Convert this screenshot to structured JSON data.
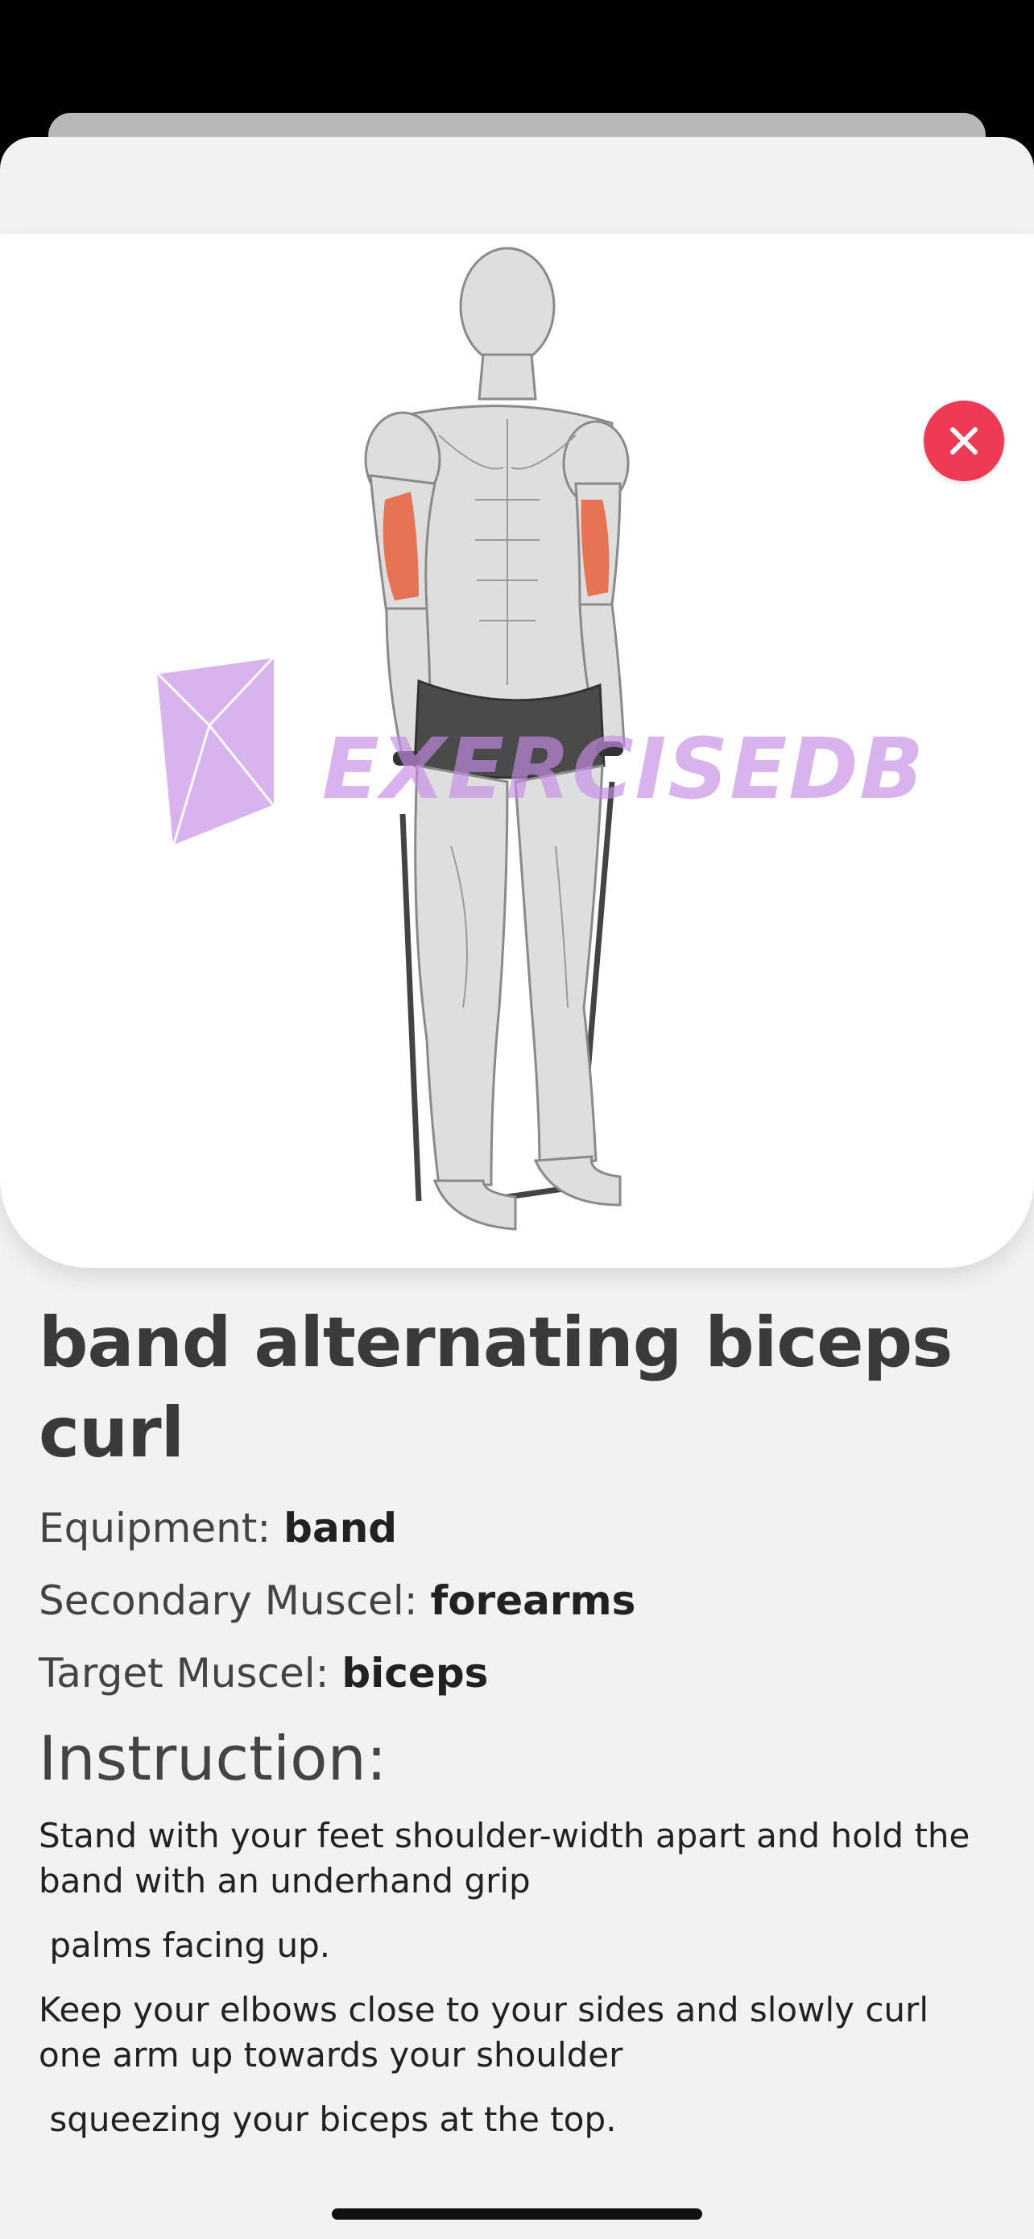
{
  "exercise": {
    "title": "band alternating biceps curl",
    "watermark": "EXERCISEDB",
    "equipment_label": "Equipment: ",
    "equipment_value": "band",
    "secondary_label": "Secondary Muscel: ",
    "secondary_value": "forearms",
    "target_label": "Target Muscel: ",
    "target_value": "biceps"
  },
  "instruction": {
    "heading": "Instruction:",
    "steps": [
      "Stand with your feet shoulder-width apart and hold the band with an underhand grip",
      " palms facing up.",
      "Keep your elbows close to your sides and slowly curl one arm up towards your shoulder",
      " squeezing your biceps at the top."
    ]
  },
  "icons": {
    "close": "close-icon",
    "logo": "exercisedb-logo-icon"
  },
  "colors": {
    "close_button": "#ee3a55",
    "highlight_muscle": "#e8603c",
    "watermark": "#c58ce6",
    "sheet_background": "#f2f2f2"
  }
}
